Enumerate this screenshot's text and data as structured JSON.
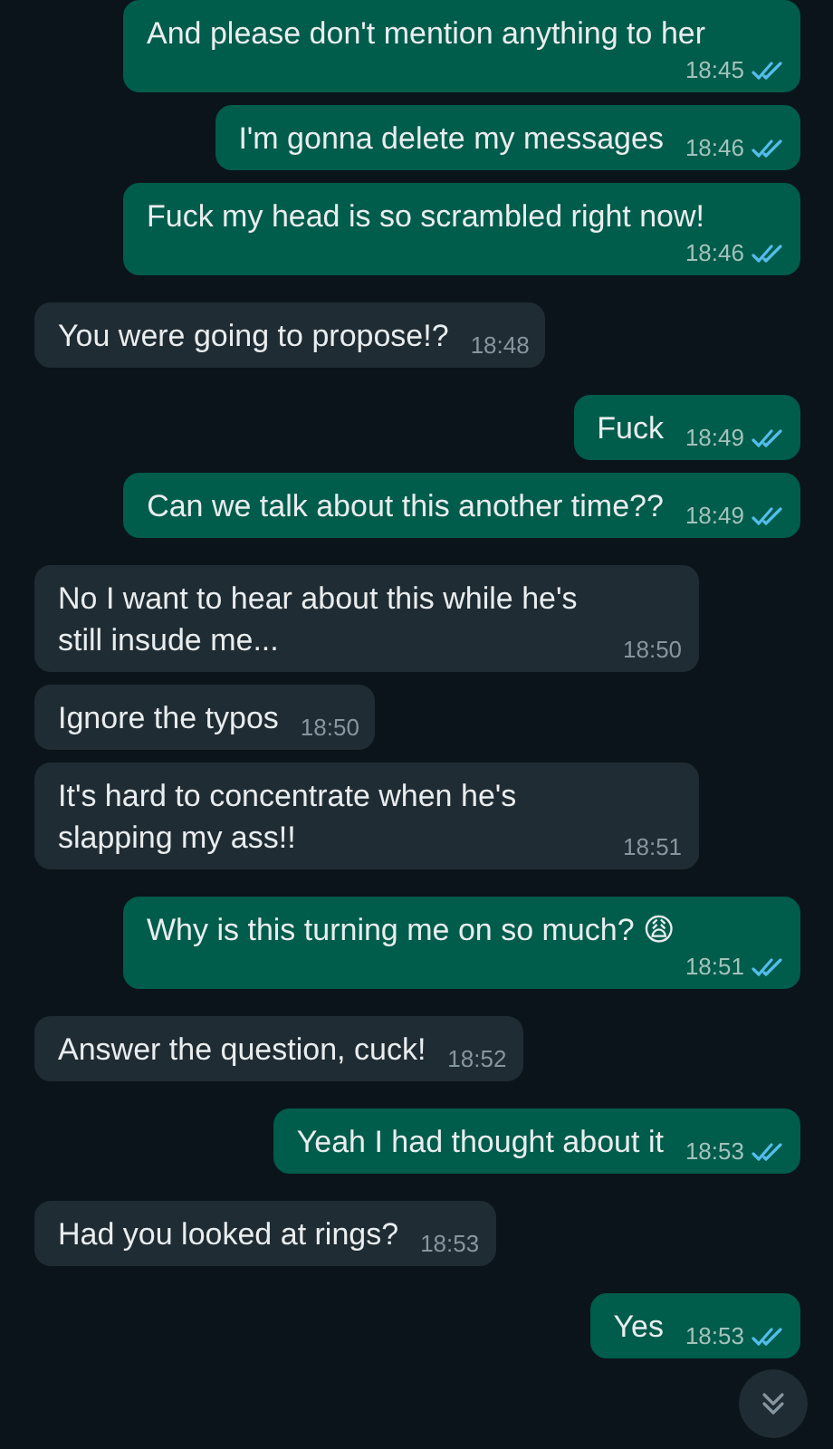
{
  "messages": [
    {
      "outgoing": true,
      "text": "And please don't mention anything to her",
      "time": "18:45",
      "read": true
    },
    {
      "outgoing": true,
      "text": "I'm gonna delete my messages",
      "time": "18:46",
      "read": true
    },
    {
      "outgoing": true,
      "text": "Fuck my head is so scrambled right now!",
      "time": "18:46",
      "read": true
    },
    {
      "outgoing": false,
      "text": "You were going to propose!?",
      "time": "18:48"
    },
    {
      "outgoing": true,
      "text": "Fuck",
      "time": "18:49",
      "read": true
    },
    {
      "outgoing": true,
      "text": "Can we talk about this another time??",
      "time": "18:49",
      "read": true
    },
    {
      "outgoing": false,
      "text": "No I want to hear about this while he's still insude me...",
      "time": "18:50"
    },
    {
      "outgoing": false,
      "text": "Ignore the typos",
      "time": "18:50"
    },
    {
      "outgoing": false,
      "text": "It's hard to concentrate when he's slapping my ass!!",
      "time": "18:51"
    },
    {
      "outgoing": true,
      "text": "Why is this turning me on so much? 😩",
      "time": "18:51",
      "read": true
    },
    {
      "outgoing": false,
      "text": "Answer the question, cuck!",
      "time": "18:52"
    },
    {
      "outgoing": true,
      "text": "Yeah I had thought about it",
      "time": "18:53",
      "read": true
    },
    {
      "outgoing": false,
      "text": "Had you looked at rings?",
      "time": "18:53"
    },
    {
      "outgoing": true,
      "text": "Yes",
      "time": "18:53",
      "read": true
    }
  ]
}
